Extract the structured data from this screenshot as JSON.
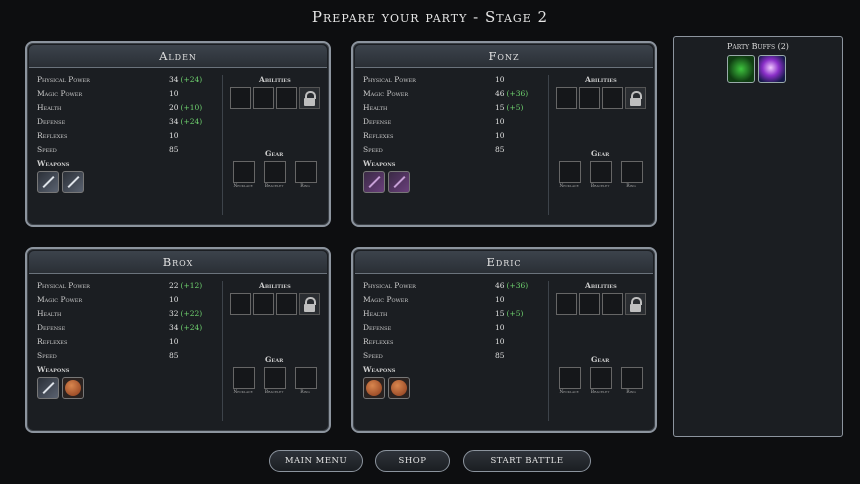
{
  "title": "Prepare your party - Stage 2",
  "party": [
    {
      "name": "Alden",
      "stats": [
        {
          "label": "Physical Power",
          "value": "34",
          "bonus": "(+24)"
        },
        {
          "label": "Magic Power",
          "value": "10",
          "bonus": ""
        },
        {
          "label": "Health",
          "value": "20",
          "bonus": "(+10)"
        },
        {
          "label": "Defense",
          "value": "34",
          "bonus": "(+24)"
        },
        {
          "label": "Reflexes",
          "value": "10",
          "bonus": ""
        },
        {
          "label": "Speed",
          "value": "85",
          "bonus": ""
        }
      ],
      "weapons_label": "Weapons",
      "weapons": [
        "sword-icon",
        "sword-icon"
      ]
    },
    {
      "name": "Fonz",
      "stats": [
        {
          "label": "Physical Power",
          "value": "10",
          "bonus": ""
        },
        {
          "label": "Magic Power",
          "value": "46",
          "bonus": "(+36)"
        },
        {
          "label": "Health",
          "value": "15",
          "bonus": "(+5)"
        },
        {
          "label": "Defense",
          "value": "10",
          "bonus": ""
        },
        {
          "label": "Reflexes",
          "value": "10",
          "bonus": ""
        },
        {
          "label": "Speed",
          "value": "85",
          "bonus": ""
        }
      ],
      "weapons_label": "Weapons",
      "weapons": [
        "staff-icon",
        "staff-icon"
      ]
    },
    {
      "name": "Brox",
      "stats": [
        {
          "label": "Physical Power",
          "value": "22",
          "bonus": "(+12)"
        },
        {
          "label": "Magic Power",
          "value": "10",
          "bonus": ""
        },
        {
          "label": "Health",
          "value": "32",
          "bonus": "(+22)"
        },
        {
          "label": "Defense",
          "value": "34",
          "bonus": "(+24)"
        },
        {
          "label": "Reflexes",
          "value": "10",
          "bonus": ""
        },
        {
          "label": "Speed",
          "value": "85",
          "bonus": ""
        }
      ],
      "weapons_label": "Weapons",
      "weapons": [
        "sword-icon",
        "shield-icon"
      ]
    },
    {
      "name": "Edric",
      "stats": [
        {
          "label": "Physical Power",
          "value": "46",
          "bonus": "(+36)"
        },
        {
          "label": "Magic Power",
          "value": "10",
          "bonus": ""
        },
        {
          "label": "Health",
          "value": "15",
          "bonus": "(+5)"
        },
        {
          "label": "Defense",
          "value": "10",
          "bonus": ""
        },
        {
          "label": "Reflexes",
          "value": "10",
          "bonus": ""
        },
        {
          "label": "Speed",
          "value": "85",
          "bonus": ""
        }
      ],
      "weapons_label": "Weapons",
      "weapons": [
        "shield-icon",
        "shield-icon"
      ]
    }
  ],
  "abilities_label": "Abilities",
  "gear_label": "Gear",
  "gear_slots": [
    "Necklace",
    "Bracelet",
    "Ring"
  ],
  "buffs": {
    "title": "Party Buffs (2)",
    "items": [
      "nature-buff-icon",
      "arcane-buff-icon"
    ]
  },
  "buttons": {
    "main_menu": "MAIN MENU",
    "shop": "SHOP",
    "start_battle": "START BATTLE"
  },
  "colors": {
    "bonus": "#6fd36f",
    "panel_border": "#8c949e",
    "background": "#0d0e10"
  }
}
